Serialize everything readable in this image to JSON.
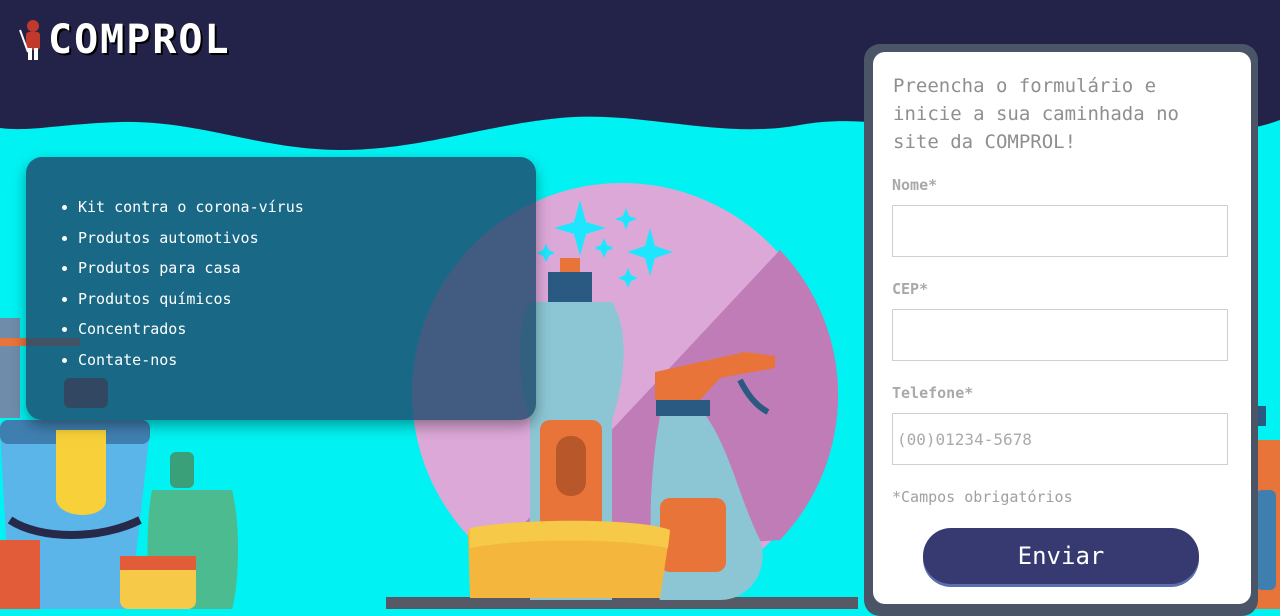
{
  "brand": {
    "name": "COMPROL"
  },
  "menu": {
    "items": [
      {
        "label": "Kit contra o corona-vírus"
      },
      {
        "label": "Produtos automotivos"
      },
      {
        "label": "Produtos para casa"
      },
      {
        "label": "Produtos químicos"
      },
      {
        "label": "Concentrados"
      },
      {
        "label": "Contate-nos"
      }
    ]
  },
  "form": {
    "heading": "Preencha o formulário e inicie a sua caminhada no site da COMPROL!",
    "nome": {
      "label": "Nome*",
      "value": "",
      "placeholder": ""
    },
    "cep": {
      "label": "CEP*",
      "value": "",
      "placeholder": ""
    },
    "telefone": {
      "label": "Telefone*",
      "value": "",
      "placeholder": "(00)01234-5678"
    },
    "required_note": "*Campos obrigatórios",
    "submit_label": "Enviar"
  },
  "colors": {
    "header_bg": "#23234a",
    "page_bg": "#00f2f2",
    "menu_panel": "#1e4a6e",
    "button": "#373a70"
  }
}
